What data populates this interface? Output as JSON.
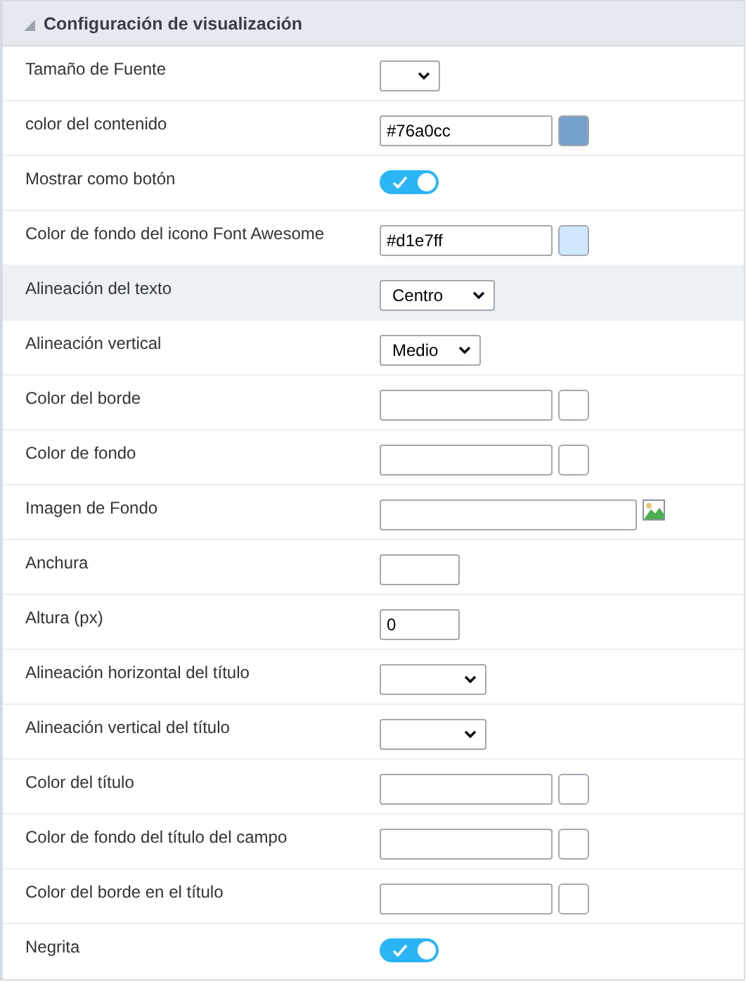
{
  "section": {
    "title": "Configuración de visualización",
    "expanded": true
  },
  "rows": [
    {
      "label": "Tamaño de Fuente",
      "kind": "select",
      "highlighted": false
    },
    {
      "label": "color del contenido",
      "kind": "color",
      "value": "#76a0cc",
      "color": "#76a0cc",
      "highlighted": false
    },
    {
      "label": "Mostrar como botón",
      "kind": "toggle",
      "on": true,
      "highlighted": false
    },
    {
      "label": "Color de fondo del icono Font Awesome",
      "kind": "color",
      "value": "#d1e7ff",
      "color": "#d1e7ff",
      "highlighted": false
    },
    {
      "label": "Alineación del texto",
      "kind": "select",
      "value": "Centro",
      "highlighted": true
    },
    {
      "label": "Alineación vertical",
      "kind": "select",
      "value": "Medio",
      "highlighted": false
    },
    {
      "label": "Color del borde",
      "kind": "color",
      "highlighted": false
    },
    {
      "label": "Color de fondo",
      "kind": "color",
      "highlighted": false
    },
    {
      "label": "Imagen de Fondo",
      "kind": "image",
      "highlighted": false
    },
    {
      "label": "Anchura",
      "kind": "text",
      "highlighted": false
    },
    {
      "label": "Altura (px)",
      "kind": "text",
      "value": "0",
      "highlighted": false
    },
    {
      "label": "Alineación horizontal del título",
      "kind": "select",
      "highlighted": false
    },
    {
      "label": "Alineación vertical del título",
      "kind": "select",
      "highlighted": false
    },
    {
      "label": "Color del título",
      "kind": "color",
      "highlighted": false
    },
    {
      "label": "Color de fondo del título del campo",
      "kind": "color",
      "highlighted": false
    },
    {
      "label": "Color del borde en el título",
      "kind": "color",
      "highlighted": false
    },
    {
      "label": "Negrita",
      "kind": "toggle",
      "on": true,
      "highlighted": false
    }
  ]
}
